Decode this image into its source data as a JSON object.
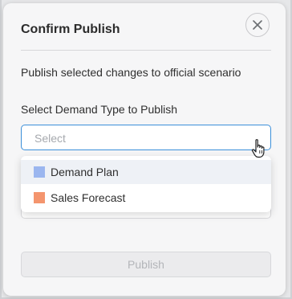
{
  "dialog": {
    "title": "Confirm Publish",
    "description": "Publish selected changes to official scenario",
    "field_label": "Select Demand Type to Publish",
    "select_placeholder": "Select",
    "publish_label": "Publish"
  },
  "dropdown": {
    "options": [
      {
        "label": "Demand Plan",
        "color": "#9bb6ef"
      },
      {
        "label": "Sales Forecast",
        "color": "#f4956e"
      }
    ]
  },
  "colors": {
    "accent_border": "#3b8fd9",
    "disabled_text": "#b3b5b9"
  },
  "icons": {
    "close": "close-icon",
    "cursor": "hand-pointer-icon"
  }
}
